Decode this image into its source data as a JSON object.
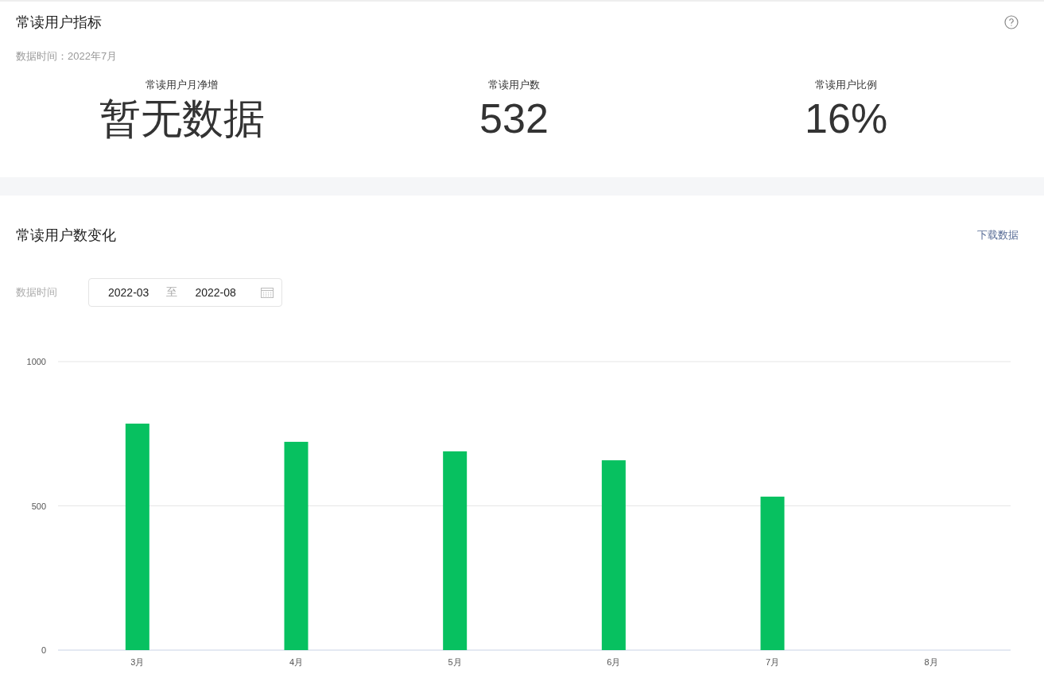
{
  "metrics_card": {
    "title": "常读用户指标",
    "data_time": "数据时间：2022年7月",
    "metrics": [
      {
        "label": "常读用户月净增",
        "value": "暂无数据"
      },
      {
        "label": "常读用户数",
        "value": "532"
      },
      {
        "label": "常读用户比例",
        "value": "16%"
      }
    ]
  },
  "trend_card": {
    "title": "常读用户数变化",
    "download_link": "下载数据",
    "filter_label": "数据时间",
    "date_range": {
      "start": "2022-03",
      "separator": "至",
      "end": "2022-08"
    },
    "chart_data": {
      "type": "bar",
      "categories": [
        "3月",
        "4月",
        "5月",
        "6月",
        "7月",
        "8月"
      ],
      "series": [
        {
          "color": "#07c160",
          "values": [
            785,
            722,
            689,
            658,
            532,
            null
          ]
        }
      ],
      "ylim": [
        0,
        1000
      ],
      "yticks": [
        0,
        500,
        1000
      ]
    }
  }
}
